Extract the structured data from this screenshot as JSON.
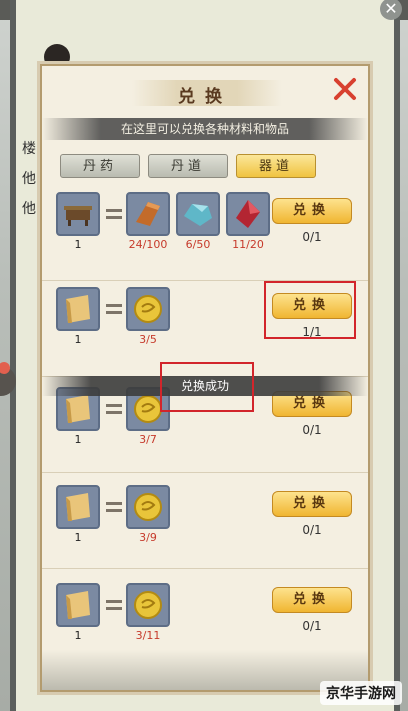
{
  "background": {
    "side_texts": [
      "楼",
      "他",
      "他"
    ]
  },
  "dialog": {
    "title": "兑换",
    "subtitle": "在这里可以兑换各种材料和物品",
    "tabs": [
      {
        "label": "丹药",
        "active": false
      },
      {
        "label": "丹道",
        "active": false
      },
      {
        "label": "器道",
        "active": true
      }
    ],
    "button_label": "兑换",
    "rows": [
      {
        "product": {
          "icon": "treasure-chest-icon",
          "qty": "1"
        },
        "materials": [
          {
            "icon": "copper-ingot-icon",
            "qty": "24/100"
          },
          {
            "icon": "jade-stone-icon",
            "qty": "6/50"
          },
          {
            "icon": "red-crystal-icon",
            "qty": "11/20"
          }
        ],
        "count": "0/1"
      },
      {
        "product": {
          "icon": "scroll-icon",
          "qty": "1"
        },
        "materials": [
          {
            "icon": "gold-coin-icon",
            "qty": "3/5"
          }
        ],
        "count": "1/1"
      },
      {
        "product": {
          "icon": "scroll-icon",
          "qty": "1"
        },
        "materials": [
          {
            "icon": "gold-coin-icon",
            "qty": "3/7"
          }
        ],
        "count": "0/1"
      },
      {
        "product": {
          "icon": "scroll-icon",
          "qty": "1"
        },
        "materials": [
          {
            "icon": "gold-coin-icon",
            "qty": "3/9"
          }
        ],
        "count": "0/1"
      },
      {
        "product": {
          "icon": "scroll-icon",
          "qty": "1"
        },
        "materials": [
          {
            "icon": "gold-coin-icon",
            "qty": "3/11"
          }
        ],
        "count": "0/1"
      }
    ],
    "toast": "兑换成功"
  },
  "watermark": {
    "logo_text": "京华手游网"
  },
  "colors": {
    "accent_gold": "#f0b531",
    "highlight_red": "#d2252b",
    "shortage_red": "#c63a2b"
  }
}
